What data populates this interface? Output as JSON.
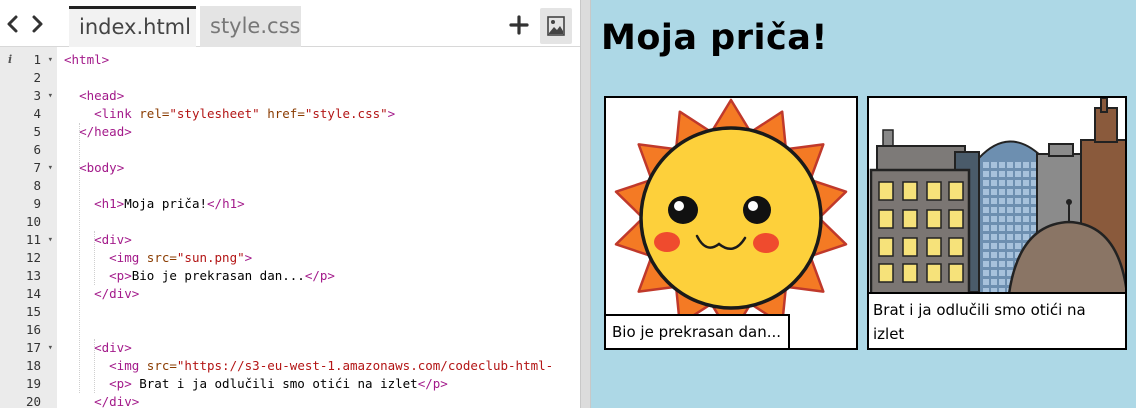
{
  "editor": {
    "tabs": [
      {
        "label": "index.html",
        "active": true
      },
      {
        "label": "style.css",
        "active": false
      }
    ],
    "icons": {
      "back": "chevron-left-icon",
      "forward": "chevron-right-icon",
      "add": "plus-icon",
      "image": "image-icon"
    },
    "info_marker": "i",
    "lines": [
      {
        "n": 1,
        "fold": true,
        "indent": 0,
        "parts": [
          [
            "tag",
            "<html>"
          ]
        ]
      },
      {
        "n": 2,
        "fold": false,
        "indent": 0,
        "parts": []
      },
      {
        "n": 3,
        "fold": true,
        "indent": 2,
        "parts": [
          [
            "tag",
            "<head>"
          ]
        ]
      },
      {
        "n": 4,
        "fold": false,
        "indent": 4,
        "parts": [
          [
            "tag",
            "<link "
          ],
          [
            "attr",
            "rel="
          ],
          [
            "str",
            "\"stylesheet\""
          ],
          [
            "txt",
            " "
          ],
          [
            "attr",
            "href="
          ],
          [
            "str",
            "\"style.css\""
          ],
          [
            "tag",
            ">"
          ]
        ]
      },
      {
        "n": 5,
        "fold": false,
        "indent": 2,
        "parts": [
          [
            "tag",
            "</head>"
          ]
        ]
      },
      {
        "n": 6,
        "fold": false,
        "indent": 0,
        "parts": []
      },
      {
        "n": 7,
        "fold": true,
        "indent": 2,
        "parts": [
          [
            "tag",
            "<body>"
          ]
        ]
      },
      {
        "n": 8,
        "fold": false,
        "indent": 0,
        "parts": []
      },
      {
        "n": 9,
        "fold": false,
        "indent": 4,
        "parts": [
          [
            "tag",
            "<h1>"
          ],
          [
            "txt",
            "Moja priča!"
          ],
          [
            "tag",
            "</h1>"
          ]
        ]
      },
      {
        "n": 10,
        "fold": false,
        "indent": 0,
        "parts": []
      },
      {
        "n": 11,
        "fold": true,
        "indent": 4,
        "parts": [
          [
            "tag",
            "<div>"
          ]
        ]
      },
      {
        "n": 12,
        "fold": false,
        "indent": 6,
        "parts": [
          [
            "tag",
            "<img "
          ],
          [
            "attr",
            "src="
          ],
          [
            "str",
            "\"sun.png\""
          ],
          [
            "tag",
            ">"
          ]
        ]
      },
      {
        "n": 13,
        "fold": false,
        "indent": 6,
        "parts": [
          [
            "tag",
            "<p>"
          ],
          [
            "txt",
            "Bio je prekrasan dan..."
          ],
          [
            "tag",
            "</p>"
          ]
        ]
      },
      {
        "n": 14,
        "fold": false,
        "indent": 4,
        "parts": [
          [
            "tag",
            "</div>"
          ]
        ]
      },
      {
        "n": 15,
        "fold": false,
        "indent": 0,
        "parts": []
      },
      {
        "n": 16,
        "fold": false,
        "indent": 0,
        "parts": []
      },
      {
        "n": 17,
        "fold": true,
        "indent": 4,
        "parts": [
          [
            "tag",
            "<div>"
          ]
        ]
      },
      {
        "n": 18,
        "fold": false,
        "indent": 6,
        "parts": [
          [
            "tag",
            "<img "
          ],
          [
            "attr",
            "src="
          ],
          [
            "str",
            "\"https://s3-eu-west-1.amazonaws.com/codeclub-html-"
          ]
        ]
      },
      {
        "n": 19,
        "fold": false,
        "indent": 6,
        "parts": [
          [
            "tag",
            "<p>"
          ],
          [
            "txt",
            " Brat i ja odlučili smo otići na izlet"
          ],
          [
            "tag",
            "</p>"
          ]
        ]
      },
      {
        "n": 20,
        "fold": false,
        "indent": 4,
        "parts": [
          [
            "tag",
            "</div>"
          ]
        ]
      }
    ]
  },
  "preview": {
    "background": "#add8e6",
    "title": "Moja priča!",
    "panels": [
      {
        "image": "sun-illustration",
        "caption": "Bio je prekrasan dan..."
      },
      {
        "image": "city-buildings-illustration",
        "caption": "Brat i ja odlučili smo otići na izlet"
      }
    ]
  }
}
